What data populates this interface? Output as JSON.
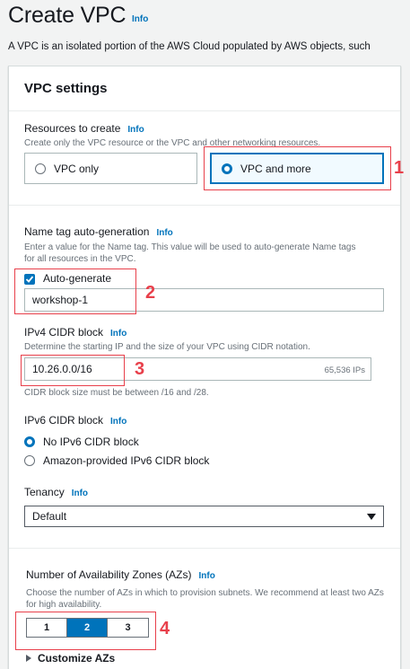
{
  "page": {
    "title": "Create VPC",
    "info": "Info",
    "intro": "A VPC is an isolated portion of the AWS Cloud populated by AWS objects, such"
  },
  "vpc_settings": {
    "title": "VPC settings",
    "resources": {
      "label": "Resources to create",
      "info": "Info",
      "description": "Create only the VPC resource or the VPC and other networking resources.",
      "options": [
        {
          "label": "VPC only",
          "selected": false
        },
        {
          "label": "VPC and more",
          "selected": true
        }
      ]
    },
    "name_tag": {
      "label": "Name tag auto-generation",
      "info": "Info",
      "description": "Enter a value for the Name tag. This value will be used to auto-generate Name tags for all resources in the VPC.",
      "checkbox_label": "Auto-generate",
      "checked": true,
      "value": "workshop-1"
    },
    "ipv4": {
      "label": "IPv4 CIDR block",
      "info": "Info",
      "description": "Determine the starting IP and the size of your VPC using CIDR notation.",
      "value": "10.26.0.0/16",
      "suffix": "65,536 IPs",
      "constraint": "CIDR block size must be between /16 and /28."
    },
    "ipv6": {
      "label": "IPv6 CIDR block",
      "info": "Info",
      "options": [
        {
          "label": "No IPv6 CIDR block",
          "selected": true
        },
        {
          "label": "Amazon-provided IPv6 CIDR block",
          "selected": false
        }
      ]
    },
    "tenancy": {
      "label": "Tenancy",
      "info": "Info",
      "value": "Default"
    },
    "azs": {
      "label": "Number of Availability Zones (AZs)",
      "info": "Info",
      "description": "Choose the number of AZs in which to provision subnets. We recommend at least two AZs for high availability.",
      "options": [
        "1",
        "2",
        "3"
      ],
      "selected": "2",
      "customize": "Customize AZs"
    }
  },
  "annotations": [
    "1",
    "2",
    "3",
    "4"
  ],
  "colors": {
    "accent": "#0073bb",
    "annotation": "#e8404b"
  }
}
